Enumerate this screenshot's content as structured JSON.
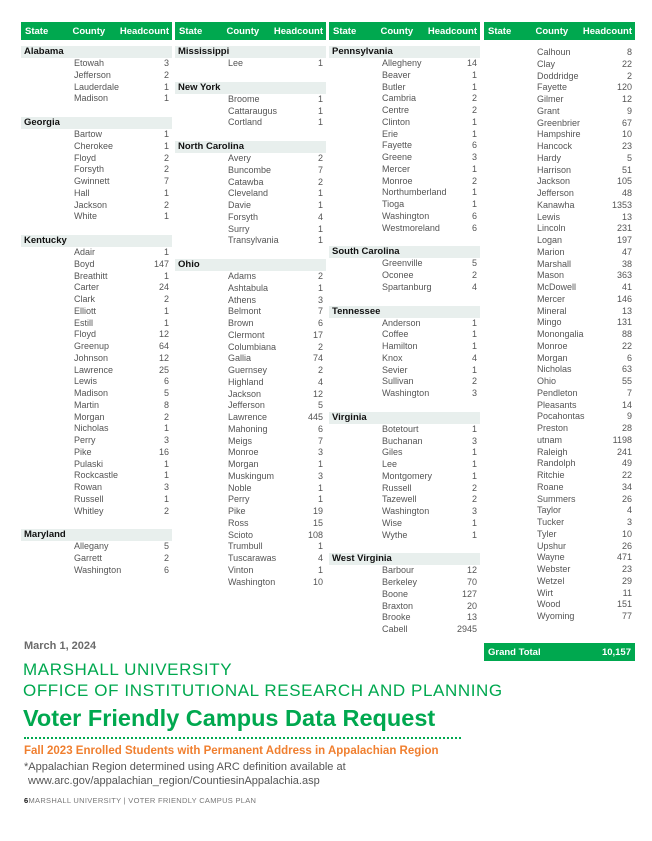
{
  "table_header": {
    "state": "State",
    "county": "County",
    "headcount": "Headcount"
  },
  "columns": [
    {
      "groups": [
        {
          "state": "Alabama",
          "rows": [
            [
              "Etowah",
              "3"
            ],
            [
              "Jefferson",
              "2"
            ],
            [
              "Lauderdale",
              "1"
            ],
            [
              "Madison",
              "1"
            ]
          ]
        },
        {
          "state": "Georgia",
          "rows": [
            [
              "Bartow",
              "1"
            ],
            [
              "Cherokee",
              "1"
            ],
            [
              "Floyd",
              "2"
            ],
            [
              "Forsyth",
              "2"
            ],
            [
              "Gwinnett",
              "7"
            ],
            [
              "Hall",
              "1"
            ],
            [
              "Jackson",
              "2"
            ],
            [
              "White",
              "1"
            ]
          ]
        },
        {
          "state": "Kentucky",
          "rows": [
            [
              "Adair",
              "1"
            ],
            [
              "Boyd",
              "147"
            ],
            [
              "Breathitt",
              "1"
            ],
            [
              "Carter",
              "24"
            ],
            [
              "Clark",
              "2"
            ],
            [
              "Elliott",
              "1"
            ],
            [
              "Estill",
              "1"
            ],
            [
              "Floyd",
              "12"
            ],
            [
              "Greenup",
              "64"
            ],
            [
              "Johnson",
              "12"
            ],
            [
              "Lawrence",
              "25"
            ],
            [
              "Lewis",
              "6"
            ],
            [
              "Madison",
              "5"
            ],
            [
              "Martin",
              "8"
            ],
            [
              "Morgan",
              "2"
            ],
            [
              "Nicholas",
              "1"
            ],
            [
              "Perry",
              "3"
            ],
            [
              "Pike",
              "16"
            ],
            [
              "Pulaski",
              "1"
            ],
            [
              "Rockcastle",
              "1"
            ],
            [
              "Rowan",
              "3"
            ],
            [
              "Russell",
              "1"
            ],
            [
              "Whitley",
              "2"
            ]
          ]
        },
        {
          "state": "Maryland",
          "rows": [
            [
              "Allegany",
              "5"
            ],
            [
              "Garrett",
              "2"
            ],
            [
              "Washington",
              "6"
            ]
          ]
        }
      ]
    },
    {
      "groups": [
        {
          "state": "Mississippi",
          "rows": [
            [
              "Lee",
              "1"
            ]
          ]
        },
        {
          "state": "New York",
          "rows": [
            [
              "Broome",
              "1"
            ],
            [
              "Cattaraugus",
              "1"
            ],
            [
              "Cortland",
              "1"
            ]
          ]
        },
        {
          "state": "North Carolina",
          "rows": [
            [
              "Avery",
              "2"
            ],
            [
              "Buncombe",
              "7"
            ],
            [
              "Catawba",
              "2"
            ],
            [
              "Cleveland",
              "1"
            ],
            [
              "Davie",
              "1"
            ],
            [
              "Forsyth",
              "4"
            ],
            [
              "Surry",
              "1"
            ],
            [
              "Transylvania",
              "1"
            ]
          ]
        },
        {
          "state": "Ohio",
          "rows": [
            [
              "Adams",
              "2"
            ],
            [
              "Ashtabula",
              "1"
            ],
            [
              "Athens",
              "3"
            ],
            [
              "Belmont",
              "7"
            ],
            [
              "Brown",
              "6"
            ],
            [
              "Clermont",
              "17"
            ],
            [
              "Columbiana",
              "2"
            ],
            [
              "Gallia",
              "74"
            ],
            [
              "Guernsey",
              "2"
            ],
            [
              "Highland",
              "4"
            ],
            [
              "Jackson",
              "12"
            ],
            [
              "Jefferson",
              "5"
            ],
            [
              "Lawrence",
              "445"
            ],
            [
              "Mahoning",
              "6"
            ],
            [
              "Meigs",
              "7"
            ],
            [
              "Monroe",
              "3"
            ],
            [
              "Morgan",
              "1"
            ],
            [
              "Muskingum",
              "3"
            ],
            [
              "Noble",
              "1"
            ],
            [
              "Perry",
              "1"
            ],
            [
              "Pike",
              "19"
            ],
            [
              "Ross",
              "15"
            ],
            [
              "Scioto",
              "108"
            ],
            [
              "Trumbull",
              "1"
            ],
            [
              "Tuscarawas",
              "4"
            ],
            [
              "Vinton",
              "1"
            ],
            [
              "Washington",
              "10"
            ]
          ]
        }
      ]
    },
    {
      "groups": [
        {
          "state": "Pennsylvania",
          "rows": [
            [
              "Allegheny",
              "14"
            ],
            [
              "Beaver",
              "1"
            ],
            [
              "Butler",
              "1"
            ],
            [
              "Cambria",
              "2"
            ],
            [
              "Centre",
              "2"
            ],
            [
              "Clinton",
              "1"
            ],
            [
              "Erie",
              "1"
            ],
            [
              "Fayette",
              "6"
            ],
            [
              "Greene",
              "3"
            ],
            [
              "Mercer",
              "1"
            ],
            [
              "Monroe",
              "2"
            ],
            [
              "Northumberland",
              "1"
            ],
            [
              "Tioga",
              "1"
            ],
            [
              "Washington",
              "6"
            ],
            [
              "Westmoreland",
              "6"
            ]
          ]
        },
        {
          "state": "South Carolina",
          "rows": [
            [
              "Greenville",
              "5"
            ],
            [
              "Oconee",
              "2"
            ],
            [
              "Spartanburg",
              "4"
            ]
          ]
        },
        {
          "state": "Tennessee",
          "rows": [
            [
              "Anderson",
              "1"
            ],
            [
              "Coffee",
              "1"
            ],
            [
              "Hamilton",
              "1"
            ],
            [
              "Knox",
              "4"
            ],
            [
              "Sevier",
              "1"
            ],
            [
              "Sullivan",
              "2"
            ],
            [
              "Washington",
              "3"
            ]
          ]
        },
        {
          "state": "Virginia",
          "rows": [
            [
              "Botetourt",
              "1"
            ],
            [
              "Buchanan",
              "3"
            ],
            [
              "Giles",
              "1"
            ],
            [
              "Lee",
              "1"
            ],
            [
              "Montgomery",
              "1"
            ],
            [
              "Russell",
              "2"
            ],
            [
              "Tazewell",
              "2"
            ],
            [
              "Washington",
              "3"
            ],
            [
              "Wise",
              "1"
            ],
            [
              "Wythe",
              "1"
            ]
          ]
        },
        {
          "state": "West Virginia",
          "rows": [
            [
              "Barbour",
              "12"
            ],
            [
              "Berkeley",
              "70"
            ],
            [
              "Boone",
              "127"
            ],
            [
              "Braxton",
              "20"
            ],
            [
              "Brooke",
              "13"
            ],
            [
              "Cabell",
              "2945"
            ]
          ]
        }
      ]
    },
    {
      "groups": [
        {
          "state": "",
          "rows": [
            [
              "Calhoun",
              "8"
            ],
            [
              "Clay",
              "22"
            ],
            [
              "Doddridge",
              "2"
            ],
            [
              "Fayette",
              "120"
            ],
            [
              "Gilmer",
              "12"
            ],
            [
              "Grant",
              "9"
            ],
            [
              "Greenbrier",
              "67"
            ],
            [
              "Hampshire",
              "10"
            ],
            [
              "Hancock",
              "23"
            ],
            [
              "Hardy",
              "5"
            ],
            [
              "Harrison",
              "51"
            ],
            [
              "Jackson",
              "105"
            ],
            [
              "Jefferson",
              "48"
            ],
            [
              "Kanawha",
              "1353"
            ],
            [
              "Lewis",
              "13"
            ],
            [
              "Lincoln",
              "231"
            ],
            [
              "Logan",
              "197"
            ],
            [
              "Marion",
              "47"
            ],
            [
              "Marshall",
              "38"
            ],
            [
              "Mason",
              "363"
            ],
            [
              "McDowell",
              "41"
            ],
            [
              "Mercer",
              "146"
            ],
            [
              "Mineral",
              "13"
            ],
            [
              "Mingo",
              "131"
            ],
            [
              "Monongalia",
              "88"
            ],
            [
              "Monroe",
              "22"
            ],
            [
              "Morgan",
              "6"
            ],
            [
              "Nicholas",
              "63"
            ],
            [
              "Ohio",
              "55"
            ],
            [
              "Pendleton",
              "7"
            ],
            [
              "Pleasants",
              "14"
            ],
            [
              "Pocahontas",
              "9"
            ],
            [
              "Preston",
              "28"
            ],
            [
              "utnam",
              "1198"
            ],
            [
              "Raleigh",
              "241"
            ],
            [
              "Randolph",
              "49"
            ],
            [
              "Ritchie",
              "22"
            ],
            [
              "Roane",
              "34"
            ],
            [
              "Summers",
              "26"
            ],
            [
              "Taylor",
              "4"
            ],
            [
              "Tucker",
              "3"
            ],
            [
              "Tyler",
              "10"
            ],
            [
              "Upshur",
              "26"
            ],
            [
              "Wayne",
              "471"
            ],
            [
              "Webster",
              "23"
            ],
            [
              "Wetzel",
              "29"
            ],
            [
              "Wirt",
              "11"
            ],
            [
              "Wood",
              "151"
            ],
            [
              "Wyoming",
              "77"
            ]
          ]
        }
      ]
    }
  ],
  "grand_total": {
    "label": "Grand Total",
    "value": "10,157"
  },
  "date": "March 1, 2024",
  "university": "MARSHALL UNIVERSITY",
  "office": "OFFICE OF INSTITUTIONAL RESEARCH AND PLANNING",
  "title": "Voter Friendly Campus Data Request",
  "subtitle": "Fall 2023 Enrolled Students with Permanent Address in Appalachian Region",
  "note_line1": "*Appalachian Region determined using ARC definition available at",
  "note_line2": "www.arc.gov/appalachian_region/CountiesinAppalachia.asp",
  "footer": {
    "page": "6",
    "text": "MARSHALL UNIVERSITY | VOTER FRIENDLY CAMPUS PLAN"
  },
  "colors": {
    "accent_green": "#00a84f",
    "accent_orange": "#f07f2f",
    "state_row_bg": "#e8efed"
  }
}
